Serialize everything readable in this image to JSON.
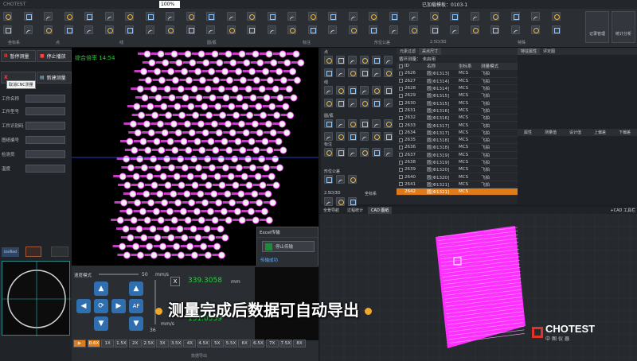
{
  "titlebar": {
    "app": "CHOTEST",
    "zoom": "100%",
    "template": "已加载模板：0103-1"
  },
  "ribbon": {
    "groups": [
      "坐标系",
      "点",
      "线",
      "圆/弧",
      "标注",
      "形位公差",
      "2.5D/3D",
      "特殊"
    ],
    "right_buttons": [
      "记录管理",
      "统计分析"
    ]
  },
  "left_panel": {
    "pause_btn": "暂停测量",
    "stop_btn": "停止播放",
    "cnc_tooltip": "取消CNC测量",
    "new_btn": "新建测量",
    "cancel_glyph": "X",
    "fields": [
      "工件名称",
      "工件型号",
      "工件识别码",
      "图纸编号",
      "检测员",
      "温度"
    ],
    "tabs": [
      "Unified"
    ]
  },
  "viewport": {
    "rate_label": "综合倍率",
    "rate_value": "14:54"
  },
  "excel_popup": {
    "title": "Excel传输",
    "stop_btn": "停止传输",
    "status": "传输成功"
  },
  "control": {
    "speed_label": "速度模式",
    "speed_value": "50",
    "speed_unit": "mm/s",
    "speed2_value": "36",
    "speed2_unit": "mm/s",
    "x_label": "X",
    "x_value": "339.3058",
    "unit": "mm",
    "y_value": "151.0539",
    "af": "AF",
    "speeds": [
      "0.6X",
      "1X",
      "1.5X",
      "2X",
      "2.5X",
      "3X",
      "3.5X",
      "4X",
      "4.5X",
      "5X",
      "5.5X",
      "6X",
      "6.5X",
      "7X",
      "7.5X",
      "8X"
    ],
    "active_speed": "0.6X",
    "bottom": [
      "数据导出"
    ],
    "status": [
      "MCS"
    ]
  },
  "tool_panel": {
    "sections": [
      "点",
      "线",
      "圆/弧",
      "标注",
      "形位公差",
      "2.5D/3D",
      "坐标系",
      "其他",
      "设置"
    ]
  },
  "table": {
    "tabs": [
      "元素过滤",
      "采点尺寸"
    ],
    "header_label": "循环测量：",
    "header_value": "未启用",
    "columns": [
      "ID",
      "名称",
      "坐标系",
      "测量模式"
    ],
    "rows": [
      [
        "2626",
        "圆[Φ1313]",
        "MCS",
        "飞拍"
      ],
      [
        "2627",
        "圆[Φ1314]",
        "MCS",
        "飞拍"
      ],
      [
        "2628",
        "圆[Φ1314]",
        "MCS",
        "飞拍"
      ],
      [
        "2629",
        "圆[Φ1315]",
        "MCS",
        "飞拍"
      ],
      [
        "2630",
        "圆[Φ1315]",
        "MCS",
        "飞拍"
      ],
      [
        "2631",
        "圆[Φ1316]",
        "MCS",
        "飞拍"
      ],
      [
        "2632",
        "圆[Φ1316]",
        "MCS",
        "飞拍"
      ],
      [
        "2633",
        "圆[Φ1317]",
        "MCS",
        "飞拍"
      ],
      [
        "2634",
        "圆[Φ1317]",
        "MCS",
        "飞拍"
      ],
      [
        "2635",
        "圆[Φ1318]",
        "MCS",
        "飞拍"
      ],
      [
        "2636",
        "圆[Φ1318]",
        "MCS",
        "飞拍"
      ],
      [
        "2637",
        "圆[Φ1319]",
        "MCS",
        "飞拍"
      ],
      [
        "2638",
        "圆[Φ1319]",
        "MCS",
        "飞拍"
      ],
      [
        "2639",
        "圆[Φ1320]",
        "MCS",
        "飞拍"
      ],
      [
        "2640",
        "圆[Φ1320]",
        "MCS",
        "飞拍"
      ],
      [
        "2641",
        "圆[Φ1321]",
        "MCS",
        "飞拍"
      ],
      [
        "2642",
        "圆[Φ1321]",
        "MCS",
        ""
      ]
    ]
  },
  "props": {
    "tabs": [
      "特征属性",
      "评定图"
    ],
    "columns": [
      "属性",
      "测量值",
      "设计值",
      "上偏差",
      "下偏差"
    ]
  },
  "cad": {
    "tabs": [
      "全景导航",
      "过程统计",
      "CAD 图纸"
    ],
    "active_tab": "CAD 图纸",
    "toolbar": "+CAD 工具栏"
  },
  "caption": {
    "text": "测量完成后数据可自动导出"
  },
  "brand": {
    "name": "CHOTEST",
    "sub": "中图仪器"
  },
  "colors": {
    "accent": "#e67e22",
    "magenta": "#ff40ff",
    "blue": "#2f6fb0"
  }
}
